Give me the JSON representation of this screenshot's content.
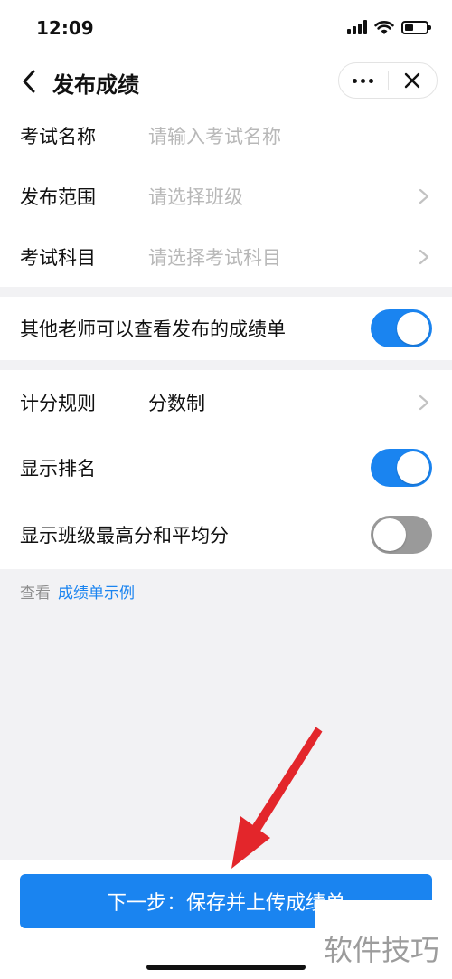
{
  "status_bar": {
    "time": "12:09"
  },
  "nav": {
    "title": "发布成绩"
  },
  "form": {
    "exam_name": {
      "label": "考试名称",
      "placeholder": "请输入考试名称"
    },
    "scope": {
      "label": "发布范围",
      "placeholder": "请选择班级"
    },
    "subject": {
      "label": "考试科目",
      "placeholder": "请选择考试科目"
    }
  },
  "permissions": {
    "others_view": {
      "label": "其他老师可以查看发布的成绩单",
      "enabled": true
    }
  },
  "settings": {
    "scoring": {
      "label": "计分规则",
      "value": "分数制"
    },
    "show_rank": {
      "label": "显示排名",
      "enabled": true
    },
    "show_stats": {
      "label": "显示班级最高分和平均分",
      "enabled": false
    }
  },
  "hint": {
    "prefix": "查看",
    "link": "成绩单示例"
  },
  "footer": {
    "primary_button": "下一步：保存并上传成绩单"
  },
  "watermark": {
    "text": "软件技巧"
  },
  "colors": {
    "accent": "#1a84f0",
    "toggle_off": "#9a9a9a",
    "annotation_arrow": "#e3262b"
  }
}
